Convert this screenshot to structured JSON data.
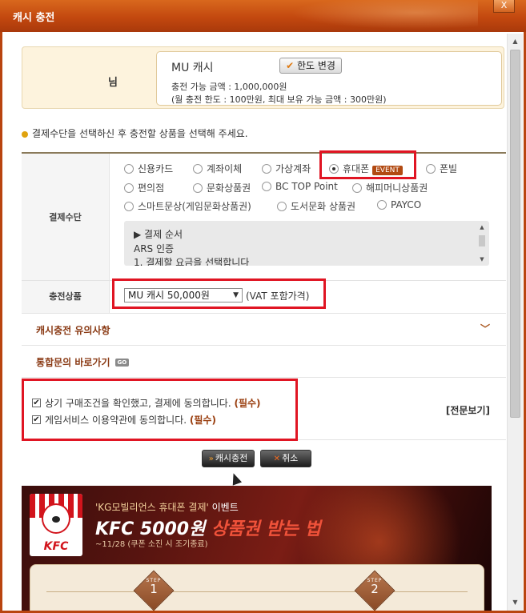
{
  "window": {
    "title": "캐시 충전",
    "close_label": "X"
  },
  "account": {
    "suffix": "님",
    "cash_name": "MU 캐시",
    "limit_button": "한도 변경",
    "charge_available": "충전 가능 금액 : 1,000,000원",
    "limits_note": "(월 충전 한도 : 100만원, 최대 보유 가능 금액 : 300만원)"
  },
  "notice": "결제수단을 선택하신 후 충전할 상품을 선택해 주세요.",
  "payment": {
    "label": "결제수단",
    "methods": [
      {
        "label": "신용카드",
        "selected": false
      },
      {
        "label": "계좌이체",
        "selected": false
      },
      {
        "label": "가상계좌",
        "selected": false
      },
      {
        "label": "휴대폰",
        "selected": true,
        "badge": "EVENT"
      },
      {
        "label": "폰빌",
        "selected": false
      },
      {
        "label": "편의점",
        "selected": false
      },
      {
        "label": "문화상품권",
        "selected": false
      },
      {
        "label": "BC TOP Point",
        "selected": false
      },
      {
        "label": "해피머니상품권",
        "selected": false
      },
      {
        "label": "스마트문상(게임문화상품권)",
        "selected": false
      },
      {
        "label": "도서문화 상품권",
        "selected": false
      },
      {
        "label": "PAYCO",
        "selected": false
      }
    ],
    "steps_title": "▶ 결제 순서",
    "steps_line1": "ARS 인증",
    "steps_line2": "1. 결제할 요금을 선택합니다"
  },
  "product": {
    "label": "충전상품",
    "selected": "MU 캐시 50,000원",
    "vat_note": "(VAT 포함가격)"
  },
  "sections": {
    "notes_title": "캐시충전 유의사항",
    "inquiry_title": "통합문의 바로가기",
    "go_badge": "GO"
  },
  "agreements": {
    "purchase": "상기 구매조건을 확인했고, 결제에 동의합니다.",
    "terms": "게임서비스 이용약관에 동의합니다.",
    "required": "(필수)",
    "view_full": "[전문보기]"
  },
  "buttons": {
    "charge": "캐시충전",
    "cancel": "취소"
  },
  "banner": {
    "brand": "KFC",
    "headline_quote": "'KG모빌리언스 휴대폰 결제'",
    "headline_suffix": "이벤트",
    "main_text": "KFC 5000원",
    "main_highlight": "상품권 받는 법",
    "period": "~11/28 (쿠폰 소진 시 조기종료)",
    "step_label": "STEP",
    "step1": "1",
    "step2": "2"
  },
  "colors": {
    "title_bar": "#c3480f",
    "highlight_box": "#e01523",
    "section_title": "#8a3a14"
  }
}
